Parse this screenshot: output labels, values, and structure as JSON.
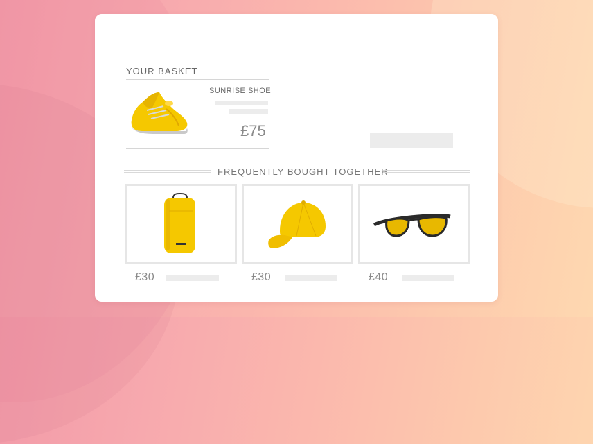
{
  "window": {
    "controls": [
      "window-dot",
      "window-dot",
      "window-dot"
    ]
  },
  "basket": {
    "title": "YOUR BASKET",
    "item": {
      "name": "SUNRISE SHOE",
      "price": "£75",
      "image": "yellow-running-shoe"
    }
  },
  "recommendations": {
    "title": "FREQUENTLY BOUGHT TOGETHER",
    "items": [
      {
        "price": "£30",
        "image": "yellow-backpack"
      },
      {
        "price": "£30",
        "image": "yellow-cap"
      },
      {
        "price": "£40",
        "image": "yellow-tinted-sunglasses"
      }
    ]
  },
  "colors": {
    "accent_yellow": "#f5c800",
    "text_gray": "#8a8a8a",
    "placeholder": "#ececec"
  }
}
